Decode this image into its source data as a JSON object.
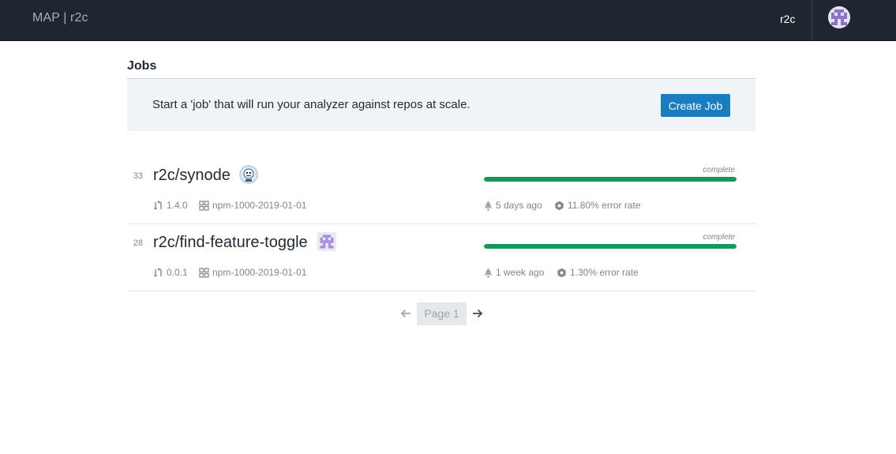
{
  "header": {
    "brand": "MAP | r2c",
    "org_link": "r2c",
    "user_avatar_icon": "pixel-avatar-icon"
  },
  "jobs_section": {
    "title": "Jobs",
    "callout_text": "Start a 'job' that will run your analyzer against repos at scale.",
    "create_button": "Create Job"
  },
  "jobs": [
    {
      "id": "33",
      "name": "r2c/synode",
      "avatar_icon": "robot-avatar-icon",
      "version": "1.4.0",
      "corpus": "npm-1000-2019-01-01",
      "time": "5 days ago",
      "error_rate": "11.80% error rate",
      "status": "complete",
      "progress": 1.0
    },
    {
      "id": "28",
      "name": "r2c/find-feature-toggle",
      "avatar_icon": "pixel-avatar-icon",
      "version": "0.0.1",
      "corpus": "npm-1000-2019-01-01",
      "time": "1 week ago",
      "error_rate": "1.30% error rate",
      "status": "complete",
      "progress": 1.0
    }
  ],
  "pagination": {
    "label": "Page 1",
    "prev_icon": "arrow-left-icon",
    "next_icon": "arrow-right-icon"
  },
  "colors": {
    "topbar": "#1f2630",
    "accent": "#1a7dbf",
    "progress": "#14995a"
  }
}
